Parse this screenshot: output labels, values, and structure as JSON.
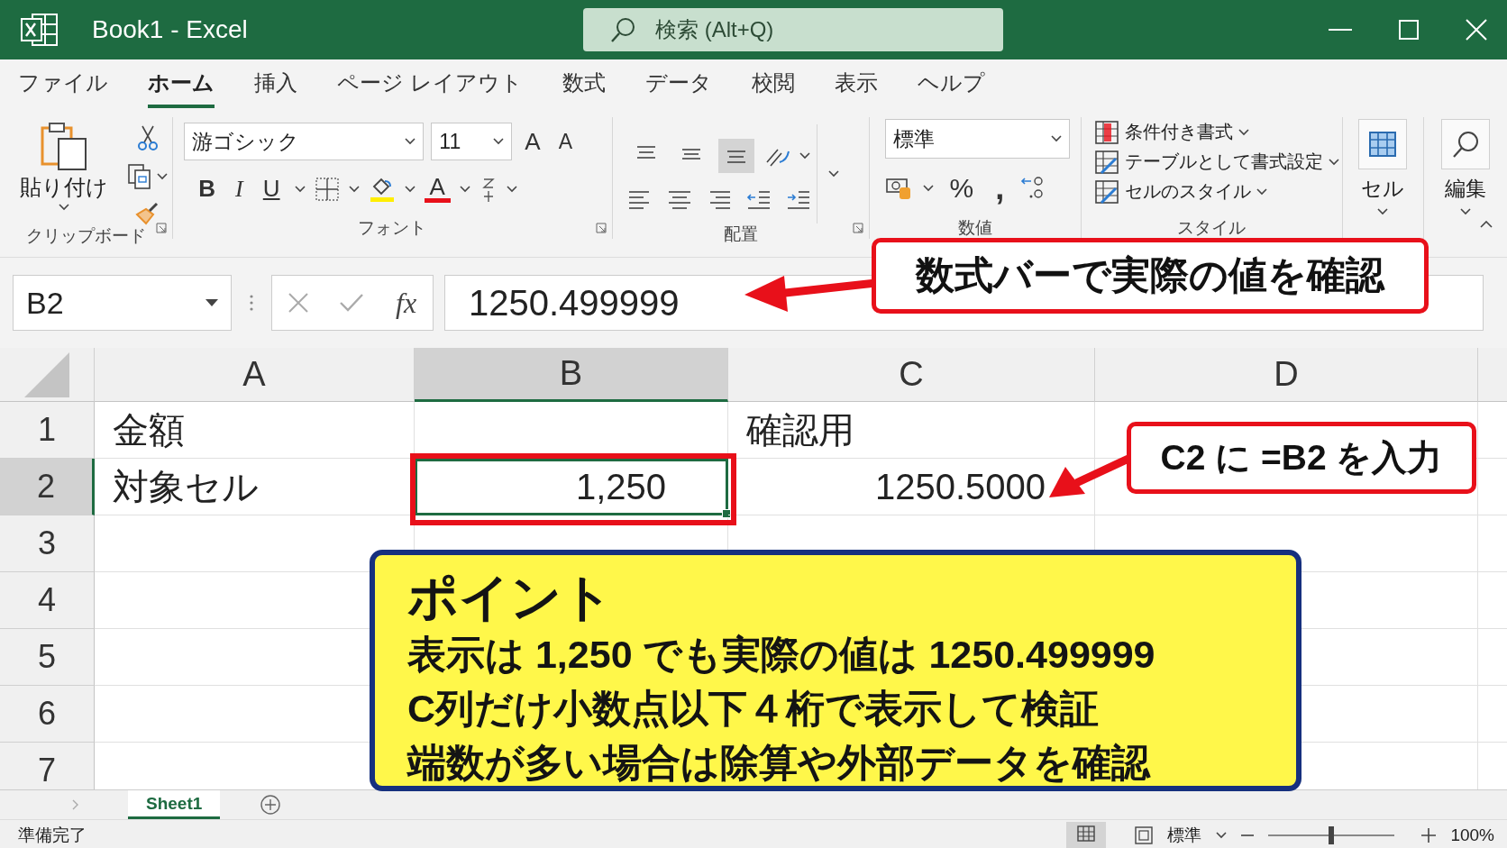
{
  "window": {
    "title": "Book1  -  Excel",
    "search_placeholder": "検索 (Alt+Q)"
  },
  "menu_tabs": [
    {
      "label": "ファイル",
      "selected": false
    },
    {
      "label": "ホーム",
      "selected": true
    },
    {
      "label": "挿入",
      "selected": false
    },
    {
      "label": "ページ レイアウト",
      "selected": false
    },
    {
      "label": "数式",
      "selected": false
    },
    {
      "label": "データ",
      "selected": false
    },
    {
      "label": "校閲",
      "selected": false
    },
    {
      "label": "表示",
      "selected": false
    },
    {
      "label": "ヘルプ",
      "selected": false
    }
  ],
  "ribbon": {
    "clipboard": {
      "paste": "貼り付け",
      "label": "クリップボード"
    },
    "font": {
      "name": "游ゴシック",
      "size": "11",
      "grow": "A",
      "shrink": "A",
      "bold": "B",
      "italic": "I",
      "underline": "U",
      "font_color_button": "A",
      "label": "フォント"
    },
    "alignment": {
      "vertical": [
        {
          "selected": false
        },
        {
          "selected": false
        },
        {
          "selected": true
        }
      ],
      "label": "配置"
    },
    "number": {
      "format": "標準",
      "percent": "%",
      "comma": ",",
      "label": "数値"
    },
    "styles": {
      "items": [
        "条件付き書式",
        "テーブルとして書式設定",
        "セルのスタイル"
      ],
      "label": "スタイル"
    },
    "cells": {
      "label": "セル"
    },
    "editing": {
      "label": "編集"
    }
  },
  "formula_bar": {
    "name_box": "B2",
    "fx": "fx",
    "value": "1250.499999"
  },
  "sheet": {
    "columns": [
      {
        "label": "A",
        "selected": false
      },
      {
        "label": "B",
        "selected": true
      },
      {
        "label": "C",
        "selected": false
      },
      {
        "label": "D",
        "selected": false
      }
    ],
    "rows": [
      {
        "label": "1",
        "selected": false,
        "cells": [
          {
            "kind": "text",
            "text": "金額"
          },
          null,
          {
            "kind": "text",
            "text": "確認用"
          },
          null
        ]
      },
      {
        "label": "2",
        "selected": true,
        "cells": [
          {
            "kind": "text",
            "text": "対象セル"
          },
          {
            "kind": "number",
            "text": "1,250",
            "selected": true
          },
          {
            "kind": "number",
            "text": "1250.5000"
          },
          null
        ]
      },
      {
        "label": "3",
        "selected": false,
        "cells": []
      },
      {
        "label": "4",
        "selected": false,
        "cells": []
      },
      {
        "label": "5",
        "selected": false,
        "cells": []
      },
      {
        "label": "6",
        "selected": false,
        "cells": []
      },
      {
        "label": "7",
        "selected": false,
        "cells": []
      }
    ]
  },
  "sheet_tabs": [
    {
      "label": "Sheet1",
      "selected": true
    }
  ],
  "status_bar": {
    "text": "準備完了",
    "view": "標準",
    "zoom": "100%",
    "zoom_slider": {
      "level": 0.5
    }
  },
  "callouts": [
    {
      "text": "数式バーで実際の値を確認"
    },
    {
      "text": "C2 に =B2 を入力"
    }
  ],
  "point_box": {
    "title": "ポイント",
    "lines": [
      "表示は 1,250 でも実際の値は 1250.499999",
      "C列だけ小数点以下４桁で表示して検証",
      "端数が多い場合は除算や外部データを確認"
    ]
  }
}
